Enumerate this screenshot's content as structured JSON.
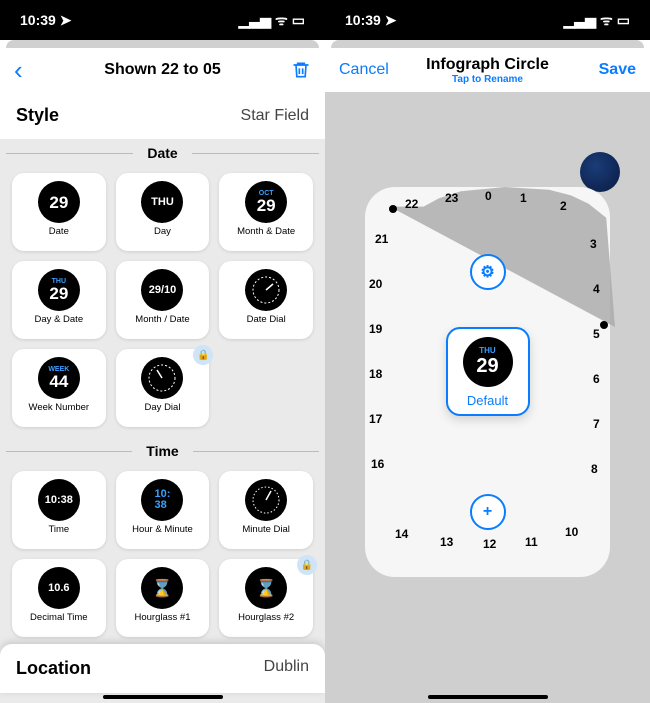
{
  "status": {
    "time": "10:39",
    "loc_icon": "➤",
    "signal": "••ll",
    "wifi": "📶",
    "battery": "🔋"
  },
  "left": {
    "nav": {
      "back": "‹",
      "title": "Shown 22 to 05",
      "trash": "🗑"
    },
    "style": {
      "label": "Style",
      "value": "Star Field"
    },
    "sections": {
      "date": {
        "title": "Date",
        "items": [
          {
            "id": "date",
            "label": "Date",
            "big": "29"
          },
          {
            "id": "day",
            "label": "Day",
            "big": "THU"
          },
          {
            "id": "month-date",
            "label": "Month & Date",
            "sup": "OCT",
            "big": "29"
          },
          {
            "id": "day-date",
            "label": "Day & Date",
            "sup": "THU",
            "big": "29"
          },
          {
            "id": "month-slash-date",
            "label": "Month / Date",
            "big": "29/10"
          },
          {
            "id": "date-dial",
            "label": "Date Dial",
            "dial": true
          },
          {
            "id": "week-number",
            "label": "Week Number",
            "sup": "WEEK",
            "big": "44"
          },
          {
            "id": "day-dial",
            "label": "Day Dial",
            "dial": true,
            "locked": true
          }
        ]
      },
      "time": {
        "title": "Time",
        "items": [
          {
            "id": "time",
            "label": "Time",
            "big": "10:38"
          },
          {
            "id": "hour-minute",
            "label": "Hour & Minute",
            "big": "10:\n38",
            "blue": true
          },
          {
            "id": "minute-dial",
            "label": "Minute Dial",
            "dial": true
          },
          {
            "id": "decimal-time",
            "label": "Decimal Time",
            "big": "10.6"
          },
          {
            "id": "hourglass-1",
            "label": "Hourglass #1",
            "hg": true
          },
          {
            "id": "hourglass-2",
            "label": "Hourglass #2",
            "hg": true,
            "locked": true
          }
        ]
      }
    },
    "location": {
      "label": "Location",
      "value": "Dublin"
    }
  },
  "right": {
    "nav": {
      "cancel": "Cancel",
      "title": "Infograph Circle",
      "sub": "Tap to Rename",
      "save": "Save"
    },
    "hours": [
      "22",
      "23",
      "0",
      "1",
      "2",
      "21",
      "3",
      "20",
      "4",
      "19",
      "5",
      "18",
      "6",
      "17",
      "7",
      "16",
      "8",
      "14",
      "13",
      "12",
      "11",
      "10"
    ],
    "range": {
      "start": "22",
      "end": "05"
    },
    "complication": {
      "day": "THU",
      "date": "29",
      "label": "Default"
    },
    "gear": "⚙︎",
    "plus": "+"
  }
}
